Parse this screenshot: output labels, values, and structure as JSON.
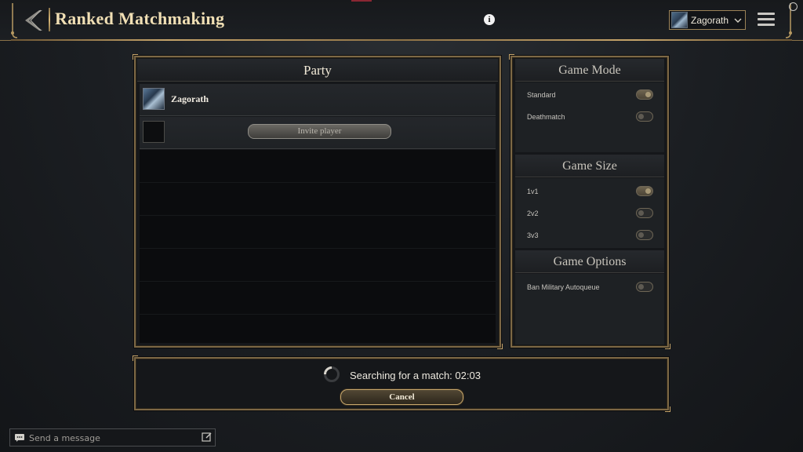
{
  "header": {
    "title": "Ranked Matchmaking",
    "info_icon": "i",
    "profile_name": "Zagorath",
    "icons": [
      "back-arrow-icon",
      "info-icon",
      "chevron-down-icon",
      "hamburger-menu-icon",
      "status-ring-icon"
    ]
  },
  "party": {
    "title": "Party",
    "members": [
      {
        "name": "Zagorath",
        "icon": "player-portrait"
      }
    ],
    "invite_label": "Invite player"
  },
  "game_mode": {
    "title": "Game Mode",
    "options": [
      {
        "label": "Standard",
        "enabled": true
      },
      {
        "label": "Deathmatch",
        "enabled": false
      }
    ]
  },
  "game_size": {
    "title": "Game Size",
    "options": [
      {
        "label": "1v1",
        "enabled": true
      },
      {
        "label": "2v2",
        "enabled": false
      },
      {
        "label": "3v3",
        "enabled": false
      }
    ]
  },
  "game_options": {
    "title": "Game Options",
    "options": [
      {
        "label": "Ban Military Autoqueue",
        "enabled": false
      }
    ]
  },
  "search": {
    "status_text": "Searching for a match: 02:03",
    "cancel_label": "Cancel"
  },
  "chat": {
    "placeholder": "Send a message"
  },
  "colors": {
    "gold_frame": "#7d6845",
    "gold_highlight": "#c6a46a",
    "title_text": "#f0dfb4",
    "background": "#1b1e22"
  }
}
